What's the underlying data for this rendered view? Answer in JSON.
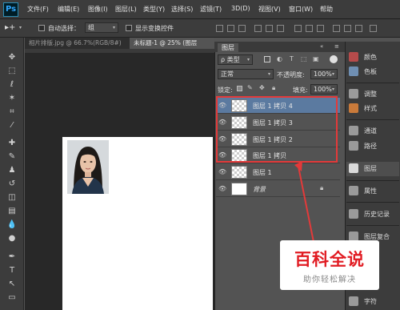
{
  "app": {
    "logo": "Ps"
  },
  "menu": [
    "文件(F)",
    "编辑(E)",
    "图像(I)",
    "图层(L)",
    "类型(Y)",
    "选择(S)",
    "滤镜(T)",
    "3D(D)",
    "视图(V)",
    "窗口(W)",
    "帮助"
  ],
  "options": {
    "auto_select_label": "自动选择：",
    "auto_select_value": "组",
    "transform_label": "显示变换控件"
  },
  "doc_tabs": [
    {
      "label": "相片排版.jpg @ 66.7%(RGB/8#)",
      "active": false
    },
    {
      "label": "未标题-1 @ 25% (图层",
      "active": true
    }
  ],
  "layers_panel": {
    "tab": "图层",
    "filter_kind": "ρ 类型",
    "blend_mode": "正常",
    "opacity_label": "不透明度:",
    "opacity_value": "100%",
    "lock_label": "锁定:",
    "fill_label": "填充:",
    "fill_value": "100%",
    "layers": [
      {
        "name": "图层 1 拷贝 4",
        "selected": true,
        "locked": false,
        "background": false
      },
      {
        "name": "图层 1 拷贝 3",
        "selected": false,
        "locked": false,
        "background": false
      },
      {
        "name": "图层 1 拷贝 2",
        "selected": false,
        "locked": false,
        "background": false
      },
      {
        "name": "图层 1 拷贝",
        "selected": false,
        "locked": false,
        "background": false
      },
      {
        "name": "图层 1",
        "selected": false,
        "locked": false,
        "background": false
      },
      {
        "name": "背景",
        "selected": false,
        "locked": true,
        "background": true
      }
    ]
  },
  "dock": [
    "颜色",
    "色板",
    "调整",
    "样式",
    "通道",
    "路径",
    "图层",
    "属性",
    "历史记录",
    "图层复合",
    "字符"
  ],
  "watermark": {
    "title": "百科全说",
    "subtitle": "助你轻松解决"
  },
  "colors": {
    "highlight_box": "#e33a3a",
    "selected_layer": "#5b7aa0",
    "accent": "#31a8ff"
  }
}
